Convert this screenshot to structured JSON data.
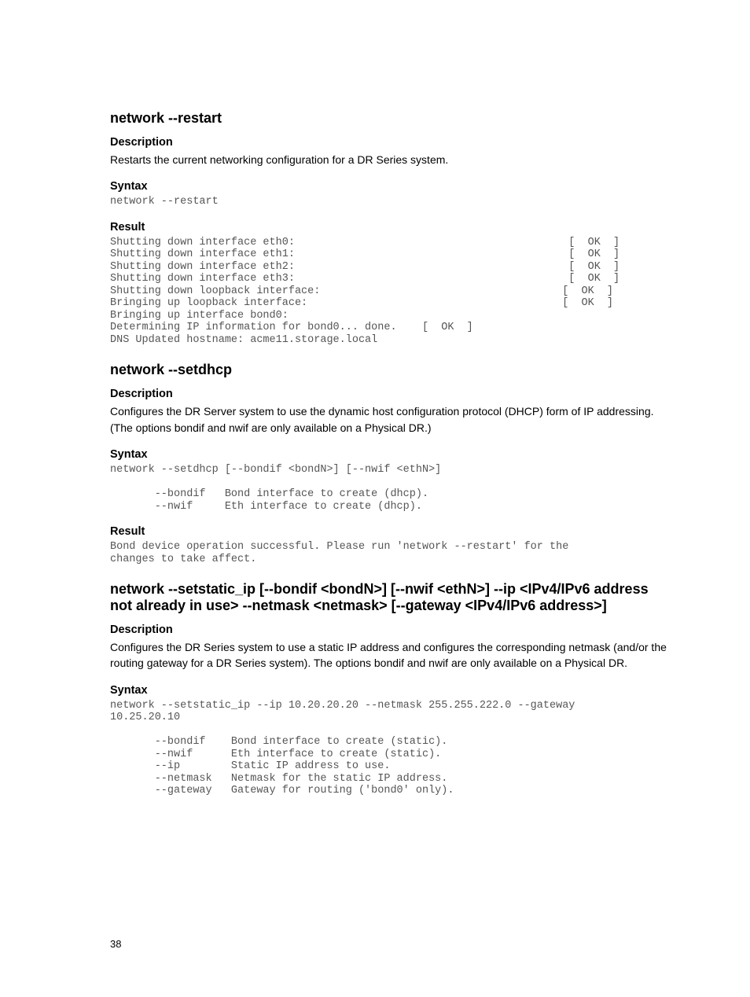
{
  "page_number": "38",
  "sections": [
    {
      "title": "network --restart",
      "description_heading": "Description",
      "description_text": "Restarts the current networking configuration for a DR Series system.",
      "syntax_heading": "Syntax",
      "syntax_code": "network --restart",
      "result_heading": "Result",
      "result_code": "Shutting down interface eth0:                                           [  OK  ]\nShutting down interface eth1:                                           [  OK  ]\nShutting down interface eth2:                                           [  OK  ]\nShutting down interface eth3:                                           [  OK  ]\nShutting down loopback interface:                                      [  OK  ]\nBringing up loopback interface:                                        [  OK  ]\nBringing up interface bond0:\nDetermining IP information for bond0... done.    [  OK  ]\nDNS Updated hostname: acme11.storage.local"
    },
    {
      "title": "network --setdhcp",
      "description_heading": "Description",
      "description_text": "Configures the DR Server system to use the dynamic host configuration protocol (DHCP) form of IP addressing. (The options bondif and nwif are only available on a Physical DR.)",
      "syntax_heading": "Syntax",
      "syntax_code": "network --setdhcp [--bondif <bondN>] [--nwif <ethN>]\n\n       --bondif   Bond interface to create (dhcp).\n       --nwif     Eth interface to create (dhcp).",
      "result_heading": "Result",
      "result_code": "Bond device operation successful. Please run 'network --restart' for the\nchanges to take affect."
    },
    {
      "title": "network --setstatic_ip [--bondif <bondN>] [--nwif <ethN>] --ip <IPv4/IPv6 address not already in use> --netmask <netmask> [--gateway <IPv4/IPv6 address>]",
      "description_heading": "Description",
      "description_text": "Configures the DR Series system to use a static IP address and configures the corresponding netmask (and/or the routing gateway for a DR Series system). The options bondif and nwif are only available on a Physical DR.",
      "syntax_heading": "Syntax",
      "syntax_code": "network --setstatic_ip --ip 10.20.20.20 --netmask 255.255.222.0 --gateway \n10.25.20.10\n\n       --bondif    Bond interface to create (static).\n       --nwif      Eth interface to create (static).\n       --ip        Static IP address to use.\n       --netmask   Netmask for the static IP address.\n       --gateway   Gateway for routing ('bond0' only)."
    }
  ]
}
